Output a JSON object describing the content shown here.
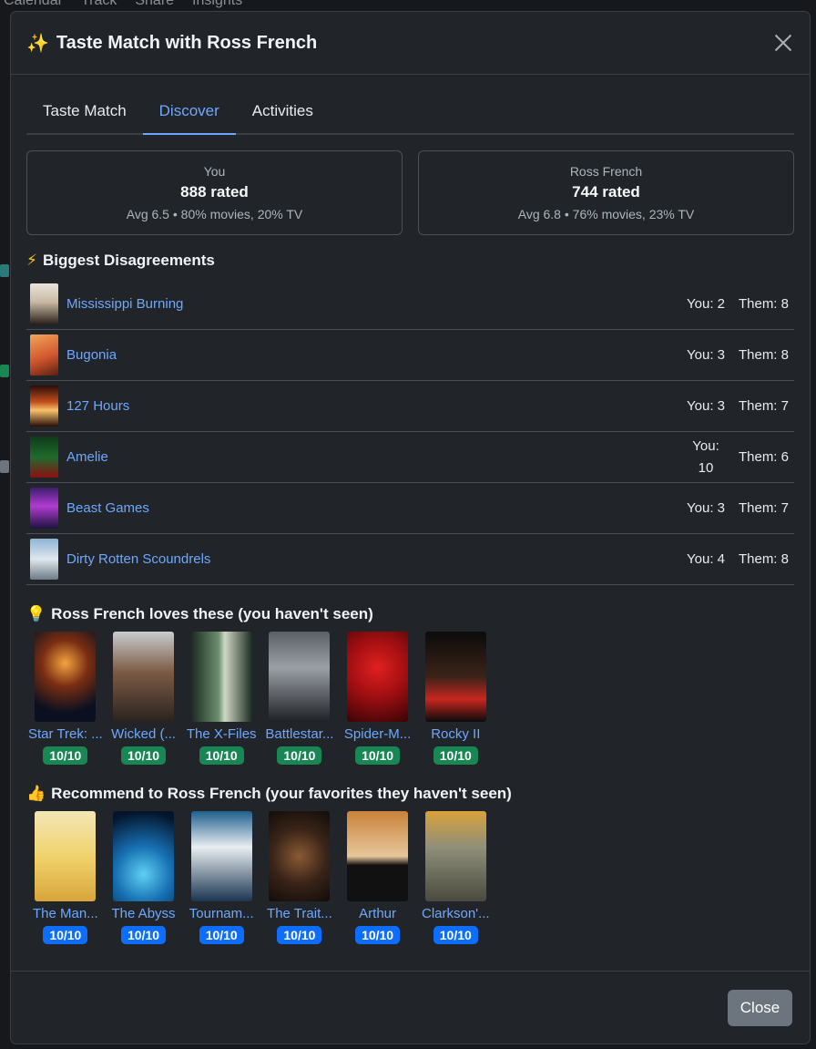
{
  "background": {
    "nav": [
      "Calendar",
      "Track",
      "Share",
      "Insights"
    ]
  },
  "modal": {
    "title": "Taste Match with Ross French",
    "tabs": [
      {
        "label": "Taste Match"
      },
      {
        "label": "Discover"
      },
      {
        "label": "Activities"
      }
    ],
    "active_tab": "Discover",
    "stats": [
      {
        "name": "You",
        "rated": "888 rated",
        "avg": "Avg 6.5 • 80% movies, 20% TV"
      },
      {
        "name": "Ross French",
        "rated": "744 rated",
        "avg": "Avg 6.8 • 76% movies, 23% TV"
      }
    ],
    "disagreements": {
      "title": "Biggest Disagreements",
      "items": [
        {
          "title": "Mississippi Burning",
          "you": "You: 2",
          "them": "Them: 8"
        },
        {
          "title": "Bugonia",
          "you": "You: 3",
          "them": "Them: 8"
        },
        {
          "title": "127 Hours",
          "you": "You: 3",
          "them": "Them: 7"
        },
        {
          "title": "Amelie",
          "you": "You: 10",
          "them": "Them: 6"
        },
        {
          "title": "Beast Games",
          "you": "You: 3",
          "them": "Them: 7"
        },
        {
          "title": "Dirty Rotten Scoundrels",
          "you": "You: 4",
          "them": "Them: 8"
        }
      ]
    },
    "they_love": {
      "title": "Ross French loves these (you haven't seen)",
      "items": [
        {
          "label": "Star Trek: ...",
          "score": "10/10"
        },
        {
          "label": "Wicked (...",
          "score": "10/10"
        },
        {
          "label": "The X-Files",
          "score": "10/10"
        },
        {
          "label": "Battlestar...",
          "score": "10/10"
        },
        {
          "label": "Spider-M...",
          "score": "10/10"
        },
        {
          "label": "Rocky II",
          "score": "10/10"
        }
      ]
    },
    "recommend": {
      "title": "Recommend to Ross French (your favorites they haven't seen)",
      "items": [
        {
          "label": "The Man...",
          "score": "10/10"
        },
        {
          "label": "The Abyss",
          "score": "10/10"
        },
        {
          "label": "Tournam...",
          "score": "10/10"
        },
        {
          "label": "The Trait...",
          "score": "10/10"
        },
        {
          "label": "Arthur",
          "score": "10/10"
        },
        {
          "label": "Clarkson'...",
          "score": "10/10"
        }
      ]
    },
    "close_label": "Close",
    "colors": {
      "accent": "#6ea8fe",
      "green_badge": "#198754",
      "blue_badge": "#0d6efd"
    }
  }
}
